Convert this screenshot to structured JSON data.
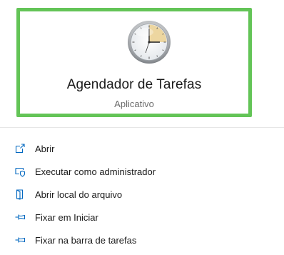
{
  "app": {
    "name": "Agendador de Tarefas",
    "type": "Aplicativo",
    "icon": "task-scheduler-clock-icon"
  },
  "actions": [
    {
      "label": "Abrir",
      "icon": "open-icon"
    },
    {
      "label": "Executar como administrador",
      "icon": "shield-admin-icon"
    },
    {
      "label": "Abrir local do arquivo",
      "icon": "file-location-icon"
    },
    {
      "label": "Fixar em Iniciar",
      "icon": "pin-icon"
    },
    {
      "label": "Fixar na barra de tarefas",
      "icon": "pin-icon"
    }
  ],
  "colors": {
    "highlight_border": "#63c457",
    "icon_accent": "#0067c0",
    "clock_sector": "#ecd49b"
  }
}
